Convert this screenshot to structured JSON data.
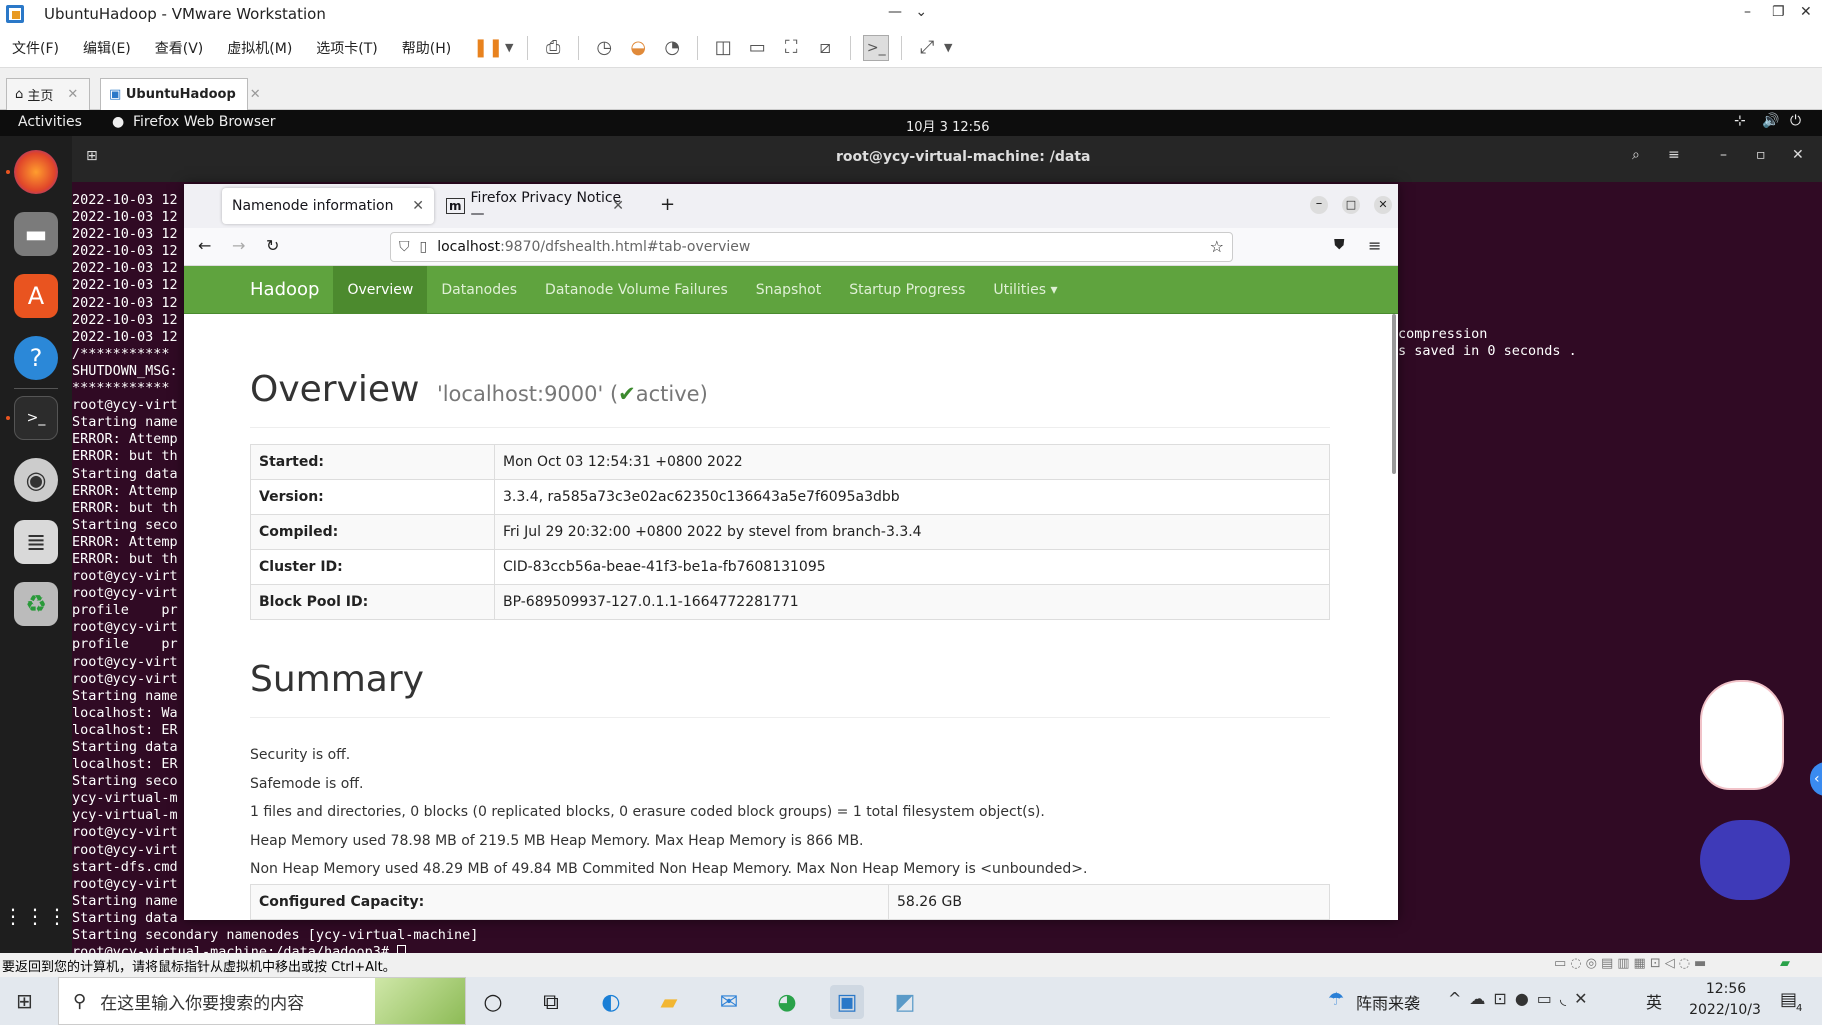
{
  "vmware": {
    "title": "UbuntuHadoop - VMware Workstation",
    "menu": [
      "文件(F)",
      "编辑(E)",
      "查看(V)",
      "虚拟机(M)",
      "选项卡(T)",
      "帮助(H)"
    ],
    "tabs": [
      {
        "label": "主页"
      },
      {
        "label": "UbuntuHadoop"
      }
    ],
    "status_text": "要返回到您的计算机，请将鼠标指针从虚拟机中移出或按 Ctrl+Alt。"
  },
  "gnome": {
    "activities": "Activities",
    "app_name": "Firefox Web Browser",
    "clock": "10月 3  12:56"
  },
  "terminal": {
    "title": "root@ycy-virtual-machine: /data",
    "lines": [
      "2022-10-03 12",
      "2022-10-03 12",
      "2022-10-03 12",
      "2022-10-03 12",
      "2022-10-03 12",
      "2022-10-03 12",
      "2022-10-03 12",
      "2022-10-03 12",
      "2022-10-03 12",
      "/***********",
      "SHUTDOWN_MSG:",
      "************",
      "root@ycy-virt",
      "Starting name",
      "ERROR: Attemp",
      "ERROR: but th",
      "Starting data",
      "ERROR: Attemp",
      "ERROR: but th",
      "Starting seco",
      "ERROR: Attemp",
      "ERROR: but th",
      "root@ycy-virt",
      "root@ycy-virt",
      "profile    pr",
      "root@ycy-virt",
      "profile    pr",
      "root@ycy-virt",
      "root@ycy-virt",
      "Starting name",
      "localhost: Wa",
      "localhost: ER",
      "Starting data",
      "localhost: ER",
      "Starting seco",
      "ycy-virtual-m",
      "ycy-virtual-m",
      "root@ycy-virt",
      "root@ycy-virt",
      "start-dfs.cmd",
      "root@ycy-virt",
      "Starting name",
      "Starting data",
      "Starting secondary namenodes [ycy-virtual-machine]",
      "root@ycy-virtual-machine:/data/hadoop3# "
    ],
    "right_lines": [
      "compression",
      "s saved in 0 seconds ."
    ]
  },
  "firefox": {
    "tabs": [
      {
        "label": "Namenode information"
      },
      {
        "label": "Firefox Privacy Notice —"
      }
    ],
    "url_host": "localhost",
    "url_rest": ":9870/dfshealth.html#tab-overview"
  },
  "hadoop": {
    "brand": "Hadoop",
    "nav": [
      "Overview",
      "Datanodes",
      "Datanode Volume Failures",
      "Snapshot",
      "Startup Progress",
      "Utilities ▾"
    ],
    "overview_title": "Overview",
    "overview_sub_pre": "'localhost:9000' (",
    "overview_sub_active": "active)",
    "info_rows": [
      {
        "k": "Started:",
        "v": "Mon Oct 03 12:54:31 +0800 2022"
      },
      {
        "k": "Version:",
        "v": "3.3.4, ra585a73c3e02ac62350c136643a5e7f6095a3dbb"
      },
      {
        "k": "Compiled:",
        "v": "Fri Jul 29 20:32:00 +0800 2022 by stevel from branch-3.3.4"
      },
      {
        "k": "Cluster ID:",
        "v": "CID-83ccb56a-beae-41f3-be1a-fb7608131095"
      },
      {
        "k": "Block Pool ID:",
        "v": "BP-689509937-127.0.1.1-1664772281771"
      }
    ],
    "summary_title": "Summary",
    "summary_lines": [
      "Security is off.",
      "Safemode is off.",
      "1 files and directories, 0 blocks (0 replicated blocks, 0 erasure coded block groups) = 1 total filesystem object(s).",
      "Heap Memory used 78.98 MB of 219.5 MB Heap Memory. Max Heap Memory is 866 MB.",
      "Non Heap Memory used 48.29 MB of 49.84 MB Commited Non Heap Memory. Max Non Heap Memory is <unbounded>."
    ],
    "capacity_label": "Configured Capacity:",
    "capacity_value": "58.26 GB"
  },
  "taskbar": {
    "search_placeholder": "在这里输入你要搜索的内容",
    "weather": "阵雨来袭",
    "ime": "英",
    "time": "12:56",
    "date": "2022/10/3",
    "notif_count": "4"
  }
}
